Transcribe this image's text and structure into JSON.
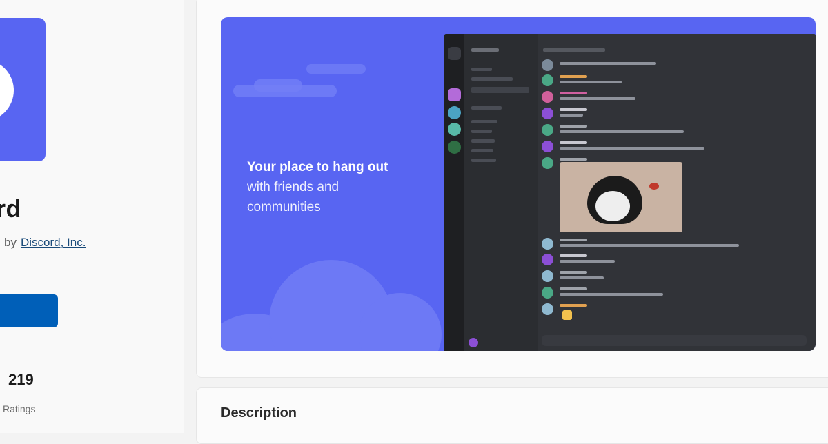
{
  "app": {
    "name": "rd",
    "publisher_prefix": "by",
    "publisher": "Discord, Inc.",
    "brand_color": "#5865f2",
    "install_button_color": "#005fb8"
  },
  "ratings": {
    "count": "219",
    "label": "Ratings"
  },
  "hero": {
    "tagline_line1": "Your place to hang out",
    "tagline_line2": "with friends and",
    "tagline_line3": "communities"
  },
  "description": {
    "heading": "Description"
  },
  "icons": {
    "logo": "discord-logo-icon"
  }
}
